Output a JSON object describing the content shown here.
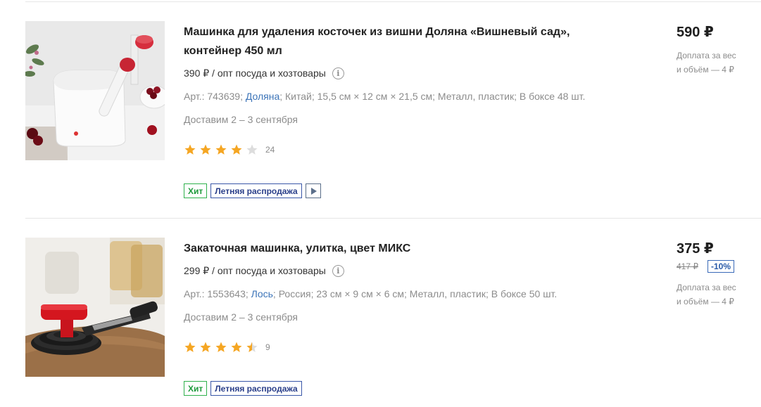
{
  "products": [
    {
      "title": "Машинка для удаления косточек из вишни Доляна «Вишневый сад», контейнер 450 мл",
      "wholesale_price": "390 ₽ / опт посуда и хозтовары",
      "specs_prefix": "Арт.: 743639; ",
      "brand": "Доляна",
      "specs_suffix": "; Китай; 15,5 см × 12 см × 21,5 см; Металл, пластик; В бокс­е 48 шт.",
      "delivery": "Доставим 2 – 3 сентября",
      "rating": 4,
      "rating_max": 5,
      "reviews": "24",
      "badge_hit": "Хит",
      "badge_sale": "Летняя распродажа",
      "has_video": true,
      "price": "590 ₽",
      "surcharge_line1": "Доплата за вес",
      "surcharge_line2": "и объём — 4 ₽",
      "thumb_icon": "cherry-pitter-image"
    },
    {
      "title": "Закаточная машинка, улитка, цвет МИКС",
      "wholesale_price": "299 ₽ / опт посуда и хозтовары",
      "specs_prefix": "Арт.: 1553643; ",
      "brand": "Лось",
      "specs_suffix": "; Россия; 23 см × 9 см × 6 см; Металл, пластик; В боксе 50 шт.",
      "delivery": "Доставим 2 – 3 сентября",
      "rating": 4.5,
      "rating_max": 5,
      "reviews": "9",
      "badge_hit": "Хит",
      "badge_sale": "Летняя распродажа",
      "has_video": false,
      "price": "375 ₽",
      "old_price": "417 ₽",
      "discount": "-10%",
      "surcharge_line1": "Доплата за вес",
      "surcharge_line2": "и объём — 4 ₽",
      "thumb_icon": "can-seamer-image"
    }
  ],
  "colors": {
    "star_filled": "#f5a623",
    "star_empty": "#dddddd",
    "brand_link": "#3c74b8",
    "hit_badge": "#1f9a3c",
    "sale_badge": "#2a3f8a"
  }
}
